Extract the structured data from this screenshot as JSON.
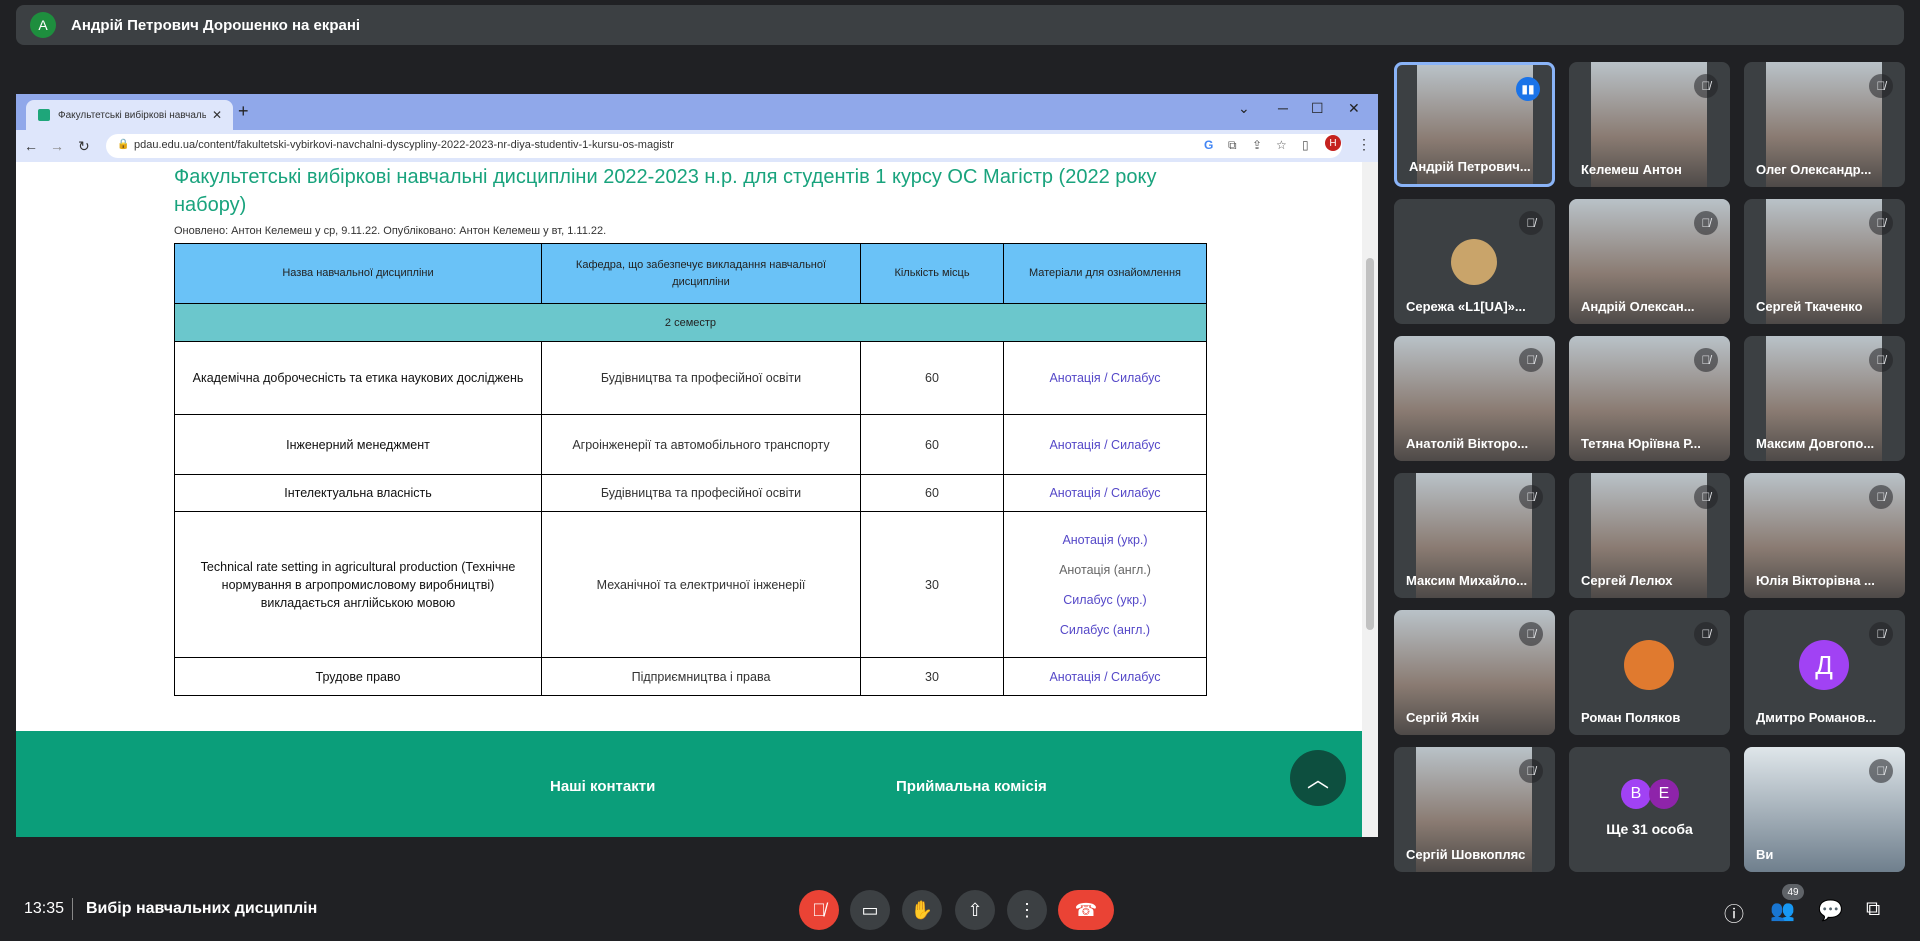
{
  "banner": {
    "avatar": "А",
    "title": "Андрій Петрович Дорошенко на екрані"
  },
  "browser": {
    "tab_title": "Факультетські вибіркові навчаль",
    "tab_close": "✕",
    "new_tab": "+",
    "url": "pdau.edu.ua/content/fakultetski-vybirkovi-navchalni-dyscypliny-2022-2023-nr-diya-studentiv-1-kursu-os-magistr",
    "profile": "Н"
  },
  "page": {
    "title": "Факультетські вибіркові навчальні дисципліни 2022-2023 н.р. для студентів 1 курсу ОС Магістр (2022 року набору)",
    "meta": "Оновлено: Антон Келемеш у ср, 9.11.22. Опубліковано: Антон Келемеш у вт, 1.11.22.",
    "headers": [
      "Назва навчальної дисципліни",
      "Кафедра, що забезпечує викладання навчальної дисципліни",
      "Кількість місць",
      "Матеріали для ознайомлення"
    ],
    "semester": "2 семестр",
    "rows": [
      {
        "name": "Академічна доброчесність та етика наукових досліджень",
        "dept": "Будівництва та професійної освіти",
        "seats": "60",
        "l1": "Анотація",
        "l2": "Силабус"
      },
      {
        "name": "Інженерний менеджмент",
        "dept": "Агроінженерії та автомобільного транспорту",
        "seats": "60",
        "l1": "Анотація",
        "l2": "Силабус"
      },
      {
        "name": "Інтелектуальна власність",
        "dept": "Будівництва та професійної освіти",
        "seats": "60",
        "l1": "Анотація",
        "l2": "Силабус"
      },
      {
        "name": "Technical rate setting in agricultural production (Технічне нормування в агропромисловому виробництві) викладається англійською мовою",
        "dept": "Механічної та електричної інженерії",
        "seats": "30",
        "links": [
          "Анотація (укр.)",
          "Анотація (англ.)",
          "Силабус (укр.)",
          "Силабус (англ.)"
        ]
      },
      {
        "name": "Трудове право",
        "dept": "Підприємництва і права",
        "seats": "30",
        "l1": "Анотація",
        "l2": "Силабус"
      }
    ],
    "link_sep": " / ",
    "footer": {
      "contacts": "Наші контакти",
      "admission": "Приймальна комісія"
    }
  },
  "participants": [
    {
      "name": "Андрій Петрович...",
      "speaking": true
    },
    {
      "name": "Келемеш Антон"
    },
    {
      "name": "Олег Олександр..."
    },
    {
      "name": "Сережа «L1[UA]»..."
    },
    {
      "name": "Андрій Олексан..."
    },
    {
      "name": "Сергей Ткаченко"
    },
    {
      "name": "Анатолій Вікторо..."
    },
    {
      "name": "Тетяна Юріївна Р..."
    },
    {
      "name": "Максим Довгопо..."
    },
    {
      "name": "Максим Михайло..."
    },
    {
      "name": "Сергей Лелюх"
    },
    {
      "name": "Юлія Вікторівна ..."
    },
    {
      "name": "Сергій Яхін"
    },
    {
      "name": "Роман Поляков"
    },
    {
      "name": "Дмитро Романов...",
      "initial": "Д",
      "color": "#a142f4"
    },
    {
      "name": "Сергій Шовкопляс"
    },
    {
      "more": "Ще 31 особа",
      "initials": [
        "В",
        "Е"
      ]
    },
    {
      "name": "Ви"
    }
  ],
  "bottom": {
    "time": "13:35",
    "meeting": "Вибір навчальних дисциплін",
    "people_count": "49"
  }
}
